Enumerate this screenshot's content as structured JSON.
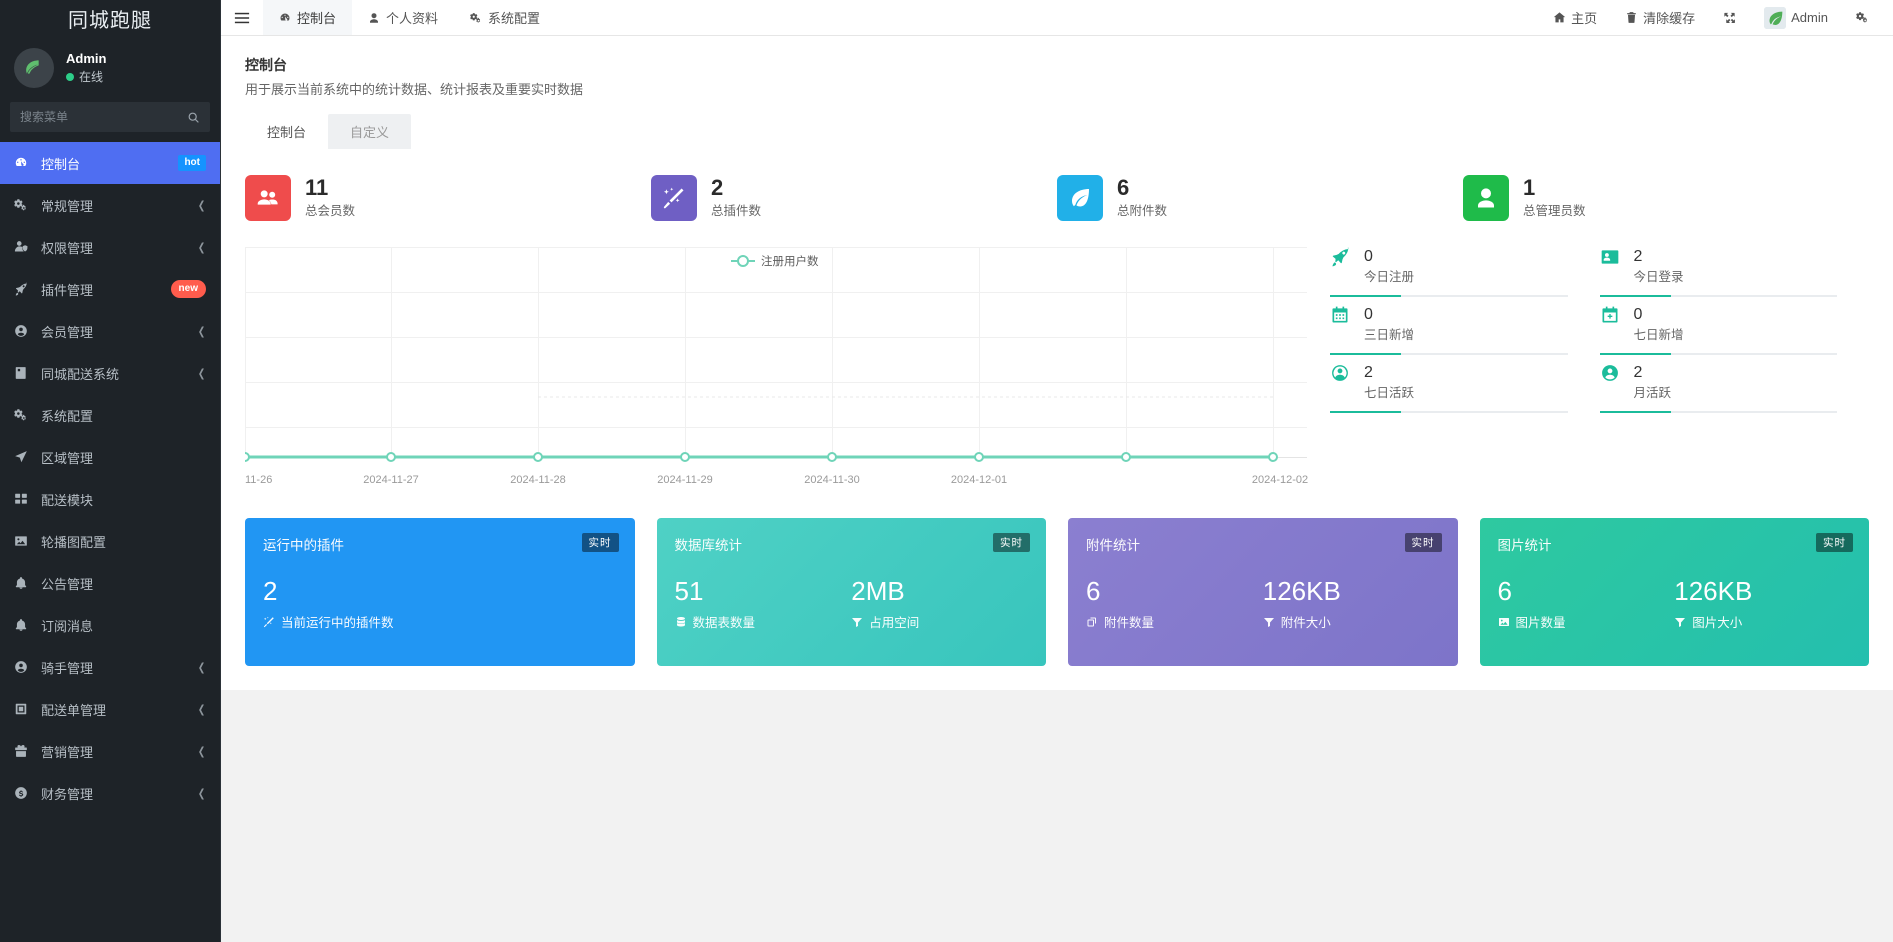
{
  "brand": {
    "title": "同城跑腿"
  },
  "user": {
    "name": "Admin",
    "status": "在线",
    "avatar_icon": "leaf-avatar-icon"
  },
  "search": {
    "placeholder": "搜索菜单",
    "icon": "search-icon",
    "value": ""
  },
  "sidebar": {
    "items": [
      {
        "label": "控制台",
        "icon": "dashboard-icon",
        "badge": "hot",
        "badge_type": "hot",
        "active": true,
        "chevron": false
      },
      {
        "label": "常规管理",
        "icon": "cogs-icon",
        "badge": "",
        "badge_type": "",
        "active": false,
        "chevron": true
      },
      {
        "label": "权限管理",
        "icon": "user-shield-icon",
        "badge": "",
        "badge_type": "",
        "active": false,
        "chevron": true
      },
      {
        "label": "插件管理",
        "icon": "rocket-icon",
        "badge": "new",
        "badge_type": "new",
        "active": false,
        "chevron": false
      },
      {
        "label": "会员管理",
        "icon": "user-circle-icon",
        "badge": "",
        "badge_type": "",
        "active": false,
        "chevron": true
      },
      {
        "label": "同城配送系统",
        "icon": "book-icon",
        "badge": "",
        "badge_type": "",
        "active": false,
        "chevron": true
      },
      {
        "label": "系统配置",
        "icon": "cogs-icon",
        "badge": "",
        "badge_type": "",
        "active": false,
        "chevron": false
      },
      {
        "label": "区域管理",
        "icon": "location-icon",
        "badge": "",
        "badge_type": "",
        "active": false,
        "chevron": false
      },
      {
        "label": "配送模块",
        "icon": "grid-icon",
        "badge": "",
        "badge_type": "",
        "active": false,
        "chevron": false
      },
      {
        "label": "轮播图配置",
        "icon": "image-icon",
        "badge": "",
        "badge_type": "",
        "active": false,
        "chevron": false
      },
      {
        "label": "公告管理",
        "icon": "bell-icon",
        "badge": "",
        "badge_type": "",
        "active": false,
        "chevron": false
      },
      {
        "label": "订阅消息",
        "icon": "bell-icon",
        "badge": "",
        "badge_type": "",
        "active": false,
        "chevron": false
      },
      {
        "label": "骑手管理",
        "icon": "user-circle-icon",
        "badge": "",
        "badge_type": "",
        "active": false,
        "chevron": true
      },
      {
        "label": "配送单管理",
        "icon": "clipboard-icon",
        "badge": "",
        "badge_type": "",
        "active": false,
        "chevron": true
      },
      {
        "label": "营销管理",
        "icon": "gift-icon",
        "badge": "",
        "badge_type": "",
        "active": false,
        "chevron": true
      },
      {
        "label": "财务管理",
        "icon": "coin-icon",
        "badge": "",
        "badge_type": "",
        "active": false,
        "chevron": true
      }
    ]
  },
  "topnav": {
    "menu_icon": "hamburger-icon",
    "items": [
      {
        "label": "控制台",
        "icon": "dashboard-icon",
        "active": true
      },
      {
        "label": "个人资料",
        "icon": "user-icon",
        "active": false
      },
      {
        "label": "系统配置",
        "icon": "cogs-icon",
        "active": false
      }
    ],
    "right": [
      {
        "label": "主页",
        "icon": "home-icon"
      },
      {
        "label": "清除缓存",
        "icon": "trash-icon"
      },
      {
        "label": "",
        "icon": "fullscreen-icon"
      },
      {
        "label": "Admin",
        "icon": "avatar-icon"
      },
      {
        "label": "",
        "icon": "gear-icon"
      }
    ]
  },
  "page": {
    "title": "控制台",
    "description": "用于展示当前系统中的统计数据、统计报表及重要实时数据",
    "tabs": [
      {
        "label": "控制台",
        "active": true
      },
      {
        "label": "自定义",
        "active": false
      }
    ]
  },
  "stats": [
    {
      "value": "11",
      "label": "总会员数",
      "color": "#ef4c4c",
      "icon": "users-icon"
    },
    {
      "value": "2",
      "label": "总插件数",
      "color": "#6f5fc4",
      "icon": "magic-wand-icon"
    },
    {
      "value": "6",
      "label": "总附件数",
      "color": "#21b0e8",
      "icon": "leaf-icon"
    },
    {
      "value": "1",
      "label": "总管理员数",
      "color": "#1fbb4a",
      "icon": "user-icon"
    }
  ],
  "side_stats": [
    {
      "value": "0",
      "label": "今日注册",
      "icon": "rocket-icon"
    },
    {
      "value": "2",
      "label": "今日登录",
      "icon": "id-card-icon"
    },
    {
      "value": "0",
      "label": "三日新增",
      "icon": "calendar-icon"
    },
    {
      "value": "0",
      "label": "七日新增",
      "icon": "calendar-plus-icon"
    },
    {
      "value": "2",
      "label": "七日活跃",
      "icon": "user-outline-icon"
    },
    {
      "value": "2",
      "label": "月活跃",
      "icon": "user-filled-icon"
    }
  ],
  "bottom_cards": [
    {
      "title": "运行中的插件",
      "tag": "实时",
      "color": "#2196f3",
      "color2": "#2196f3",
      "cols": [
        {
          "num": "2",
          "label": "当前运行中的插件数",
          "icon": "magic-wand-icon"
        }
      ]
    },
    {
      "title": "数据库统计",
      "tag": "实时",
      "color": "#4fd1c5",
      "color2": "#38c5bd",
      "cols": [
        {
          "num": "51",
          "label": "数据表数量",
          "icon": "database-icon"
        },
        {
          "num": "2MB",
          "label": "占用空间",
          "icon": "filter-icon"
        }
      ]
    },
    {
      "title": "附件统计",
      "tag": "实时",
      "color": "#8b7fd0",
      "color2": "#7d74c9",
      "cols": [
        {
          "num": "6",
          "label": "附件数量",
          "icon": "paperclip-icon"
        },
        {
          "num": "126KB",
          "label": "附件大小",
          "icon": "filter-icon"
        }
      ]
    },
    {
      "title": "图片统计",
      "tag": "实时",
      "color": "#2ec9a0",
      "color2": "#24bfae",
      "cols": [
        {
          "num": "6",
          "label": "图片数量",
          "icon": "image-icon"
        },
        {
          "num": "126KB",
          "label": "图片大小",
          "icon": "filter-icon"
        }
      ]
    }
  ],
  "chart_data": {
    "type": "line",
    "title": "",
    "legend": [
      "注册用户数"
    ],
    "legend_position": "top-center",
    "series": [
      {
        "name": "注册用户数",
        "values": [
          0,
          0,
          0,
          0,
          0,
          0,
          0
        ],
        "color": "#6fd4b8"
      }
    ],
    "categories": [
      "11-26",
      "2024-11-27",
      "2024-11-28",
      "2024-11-29",
      "2024-11-30",
      "2024-12-01",
      "2024-12-02"
    ],
    "xlabel": "",
    "ylabel": "",
    "ylim": [
      0,
      5
    ],
    "yticks": [
      0,
      1,
      2,
      3,
      4,
      5
    ],
    "grid": true
  }
}
